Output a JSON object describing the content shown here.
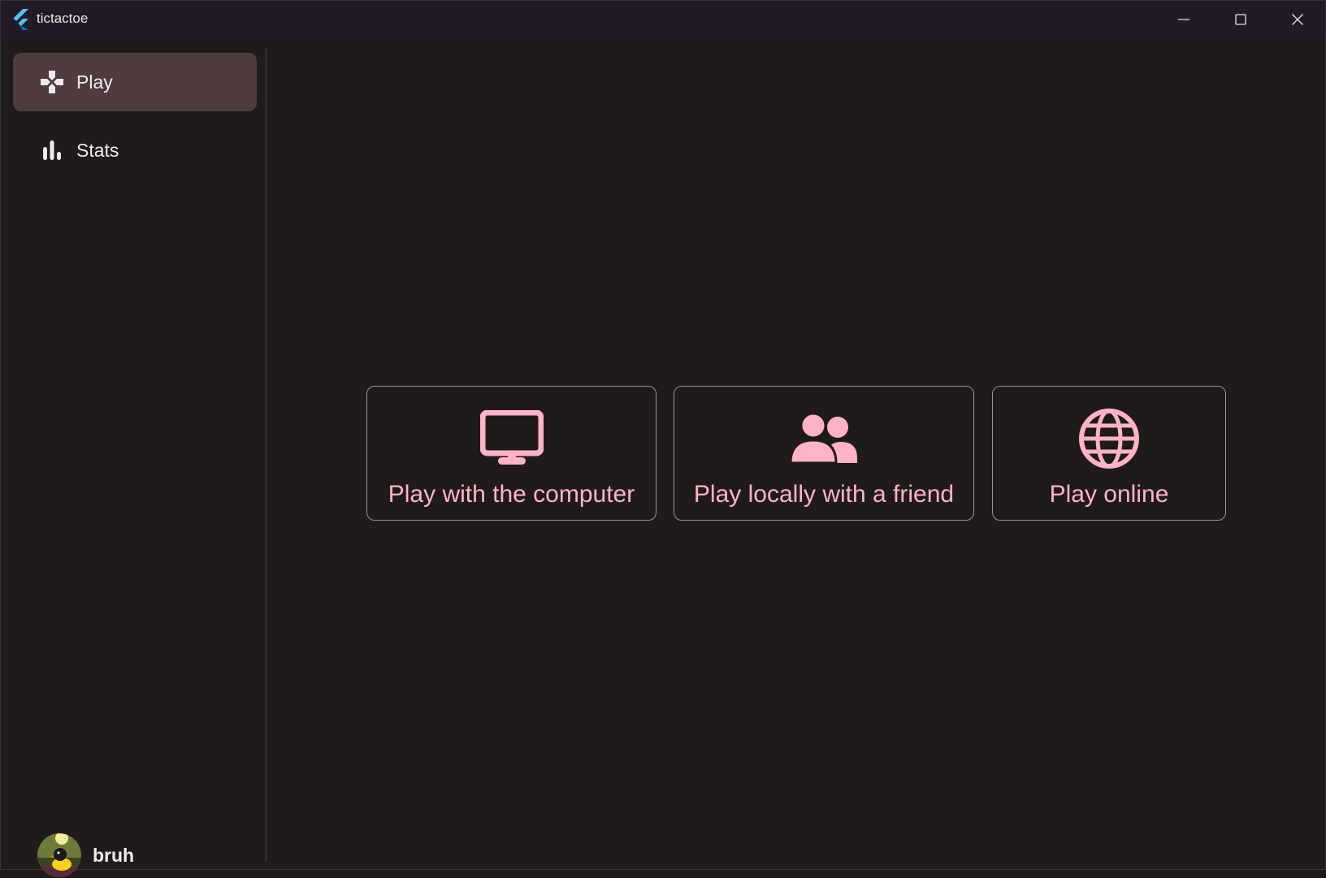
{
  "window": {
    "title": "tictactoe",
    "controls": [
      "minimize",
      "maximize",
      "close"
    ]
  },
  "sidebar": {
    "items": [
      {
        "label": "Play",
        "icon": "gamepad-icon",
        "active": true
      },
      {
        "label": "Stats",
        "icon": "bar-chart-icon",
        "active": false
      }
    ],
    "user": {
      "name": "bruh",
      "avatar": "duck-avatar"
    }
  },
  "main": {
    "modes": [
      {
        "label": "Play with the computer",
        "icon": "monitor-icon"
      },
      {
        "label": "Play locally with a friend",
        "icon": "people-icon"
      },
      {
        "label": "Play online",
        "icon": "globe-icon"
      }
    ]
  },
  "colors": {
    "accent": "#ffb3c6",
    "background": "#201b1b",
    "titlebar": "#231a27",
    "nav_active": "#4e3c3f",
    "card_border": "#9c9094",
    "text": "#f2eaec"
  }
}
